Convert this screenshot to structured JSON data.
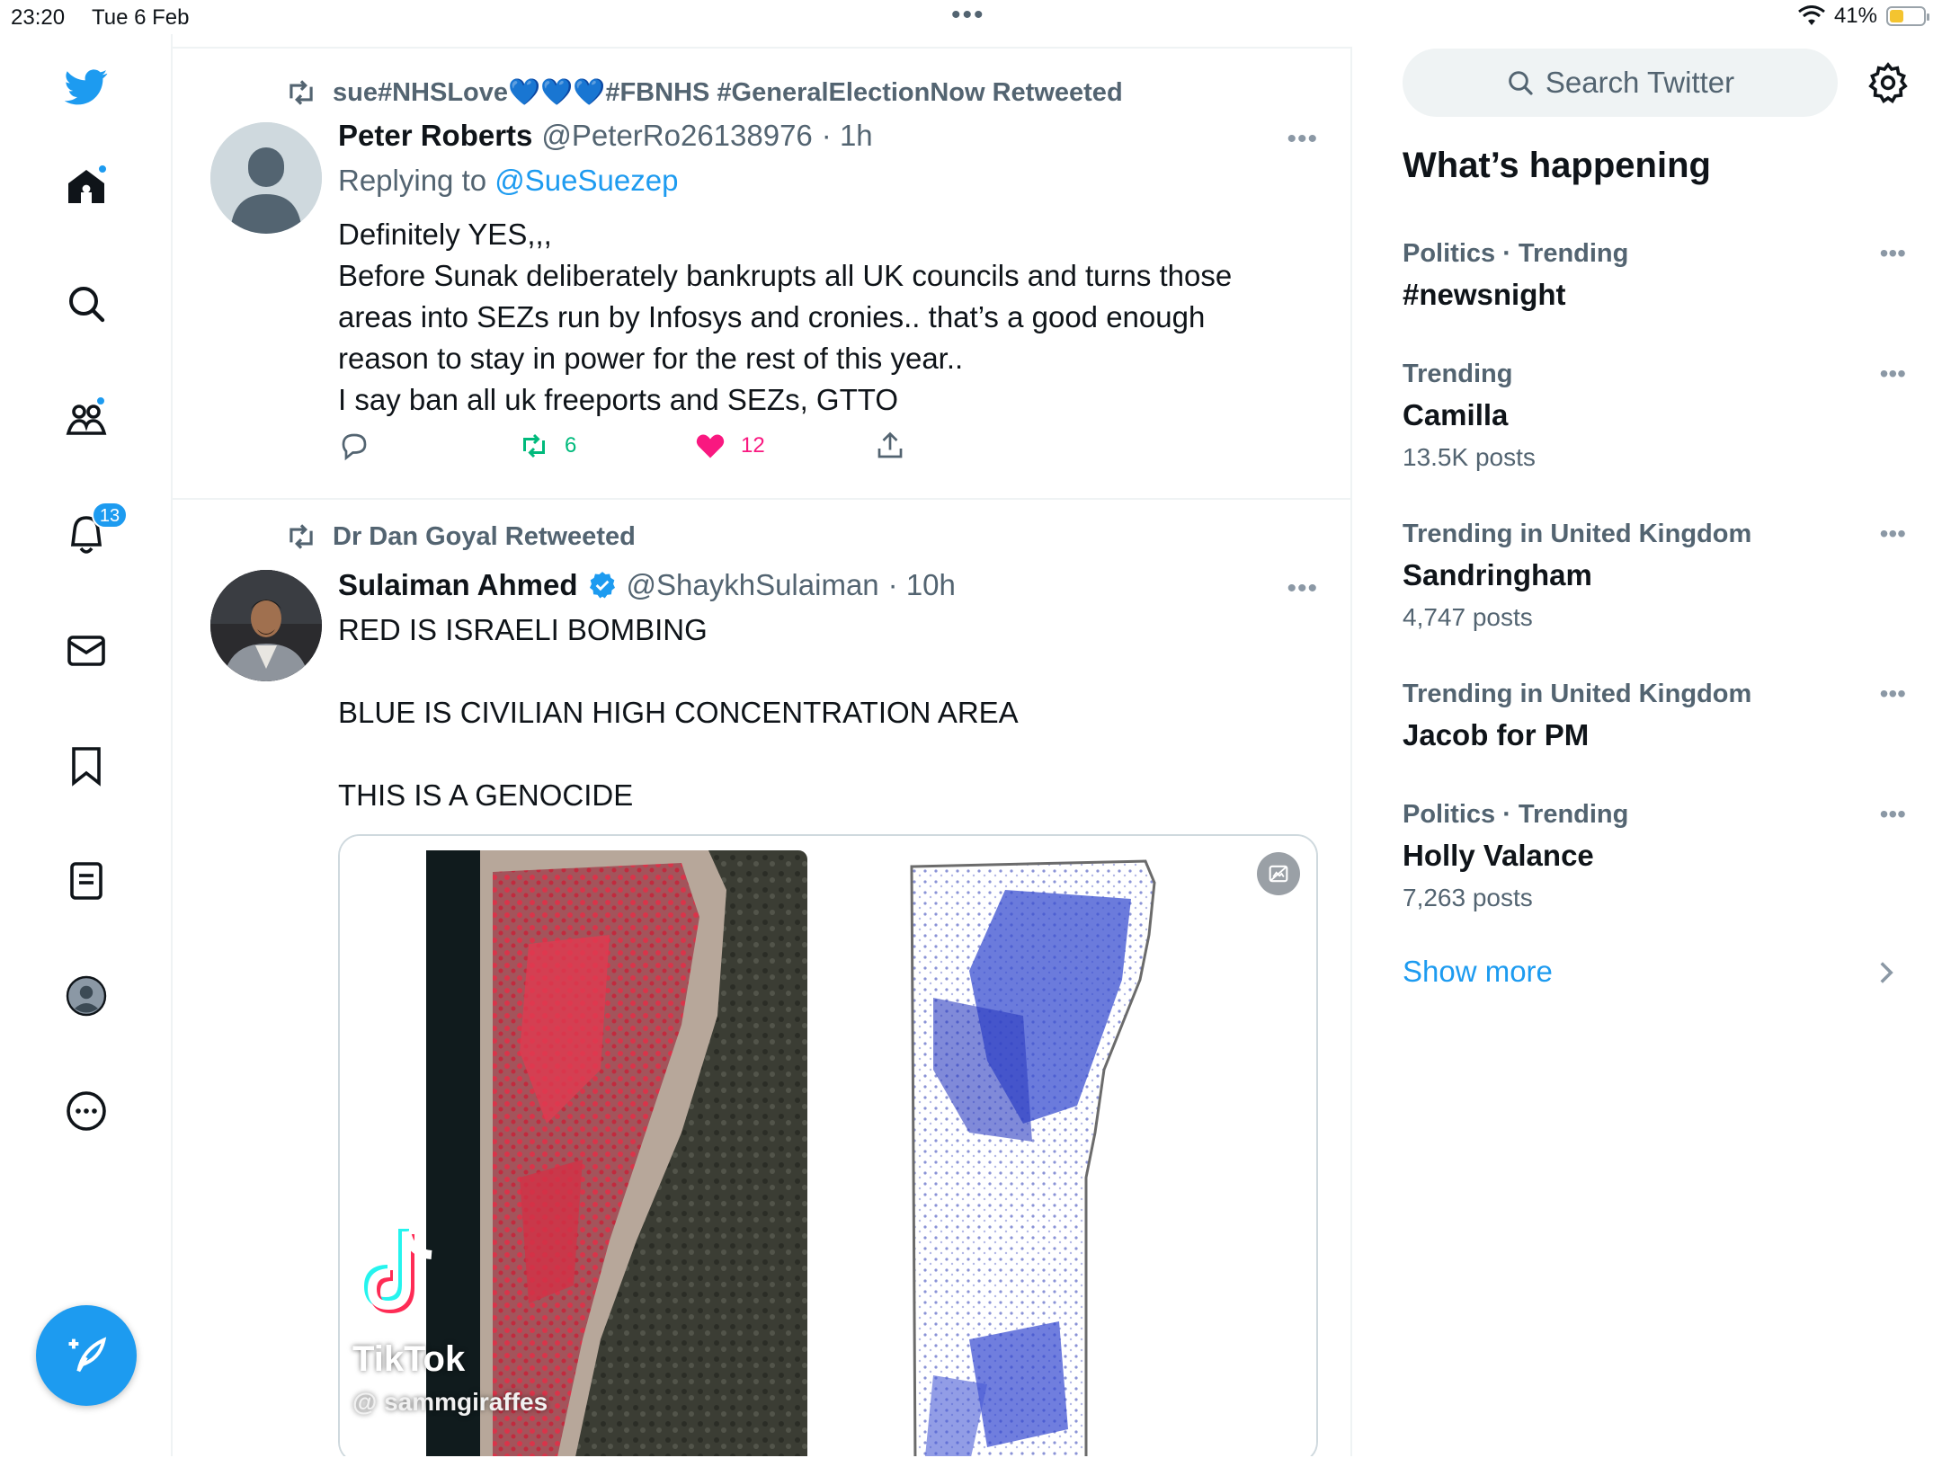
{
  "status_bar": {
    "time": "23:20",
    "date": "Tue 6 Feb",
    "center_dots": "•••",
    "battery_percent_text": "41%",
    "battery_level": 0.41
  },
  "nav": {
    "notifications_badge": "13",
    "icons": [
      "twitter-logo",
      "home-icon",
      "search-icon",
      "communities-icon",
      "notifications-icon",
      "messages-icon",
      "bookmarks-icon",
      "lists-icon",
      "profile-icon",
      "more-icon",
      "compose-icon"
    ]
  },
  "tweets": [
    {
      "retweeted_by": "sue#NHSLove💙💙💙#FBNHS #GeneralElectionNow Retweeted",
      "name": "Peter Roberts",
      "handle": "@PeterRo26138976",
      "time": "· 1h",
      "replying_prefix": "Replying to",
      "replying_to": "@SueSuezep",
      "text": "Definitely YES,,,\nBefore Sunak deliberately bankrupts all UK councils and turns those areas into SEZs run by Infosys and cronies.. that’s a good enough reason to stay in power for the rest of this year..\nI say ban all uk freeports and SEZs,  GTTO",
      "retweets": "6",
      "likes": "12"
    },
    {
      "retweeted_by": "Dr Dan Goyal Retweeted",
      "name": "Sulaiman Ahmed",
      "handle": "@ShaykhSulaiman",
      "time": "· 10h",
      "text": "RED IS ISRAELI BOMBING\n\nBLUE IS CIVILIAN HIGH CONCENTRATION AREA\n\nTHIS IS A GENOCIDE",
      "media_watermark_brand": "TikTok",
      "media_watermark_user": "@ sammgiraffes"
    }
  ],
  "more_dots": "•••",
  "sidebar": {
    "search_placeholder": "Search Twitter",
    "section_title": "What’s happening",
    "trends": [
      {
        "meta": "Politics · Trending",
        "name": "#newsnight",
        "count": ""
      },
      {
        "meta": "Trending",
        "name": "Camilla",
        "count": "13.5K posts"
      },
      {
        "meta": "Trending in United Kingdom",
        "name": "Sandringham",
        "count": "4,747 posts"
      },
      {
        "meta": "Trending in United Kingdom",
        "name": "Jacob for PM",
        "count": ""
      },
      {
        "meta": "Politics · Trending",
        "name": "Holly Valance",
        "count": "7,263 posts"
      }
    ],
    "show_more": "Show more"
  },
  "colors": {
    "brand": "#1d9bf0",
    "retweet_green": "#00ba7c",
    "like_pink": "#f91880",
    "secondary_text": "#536471"
  }
}
